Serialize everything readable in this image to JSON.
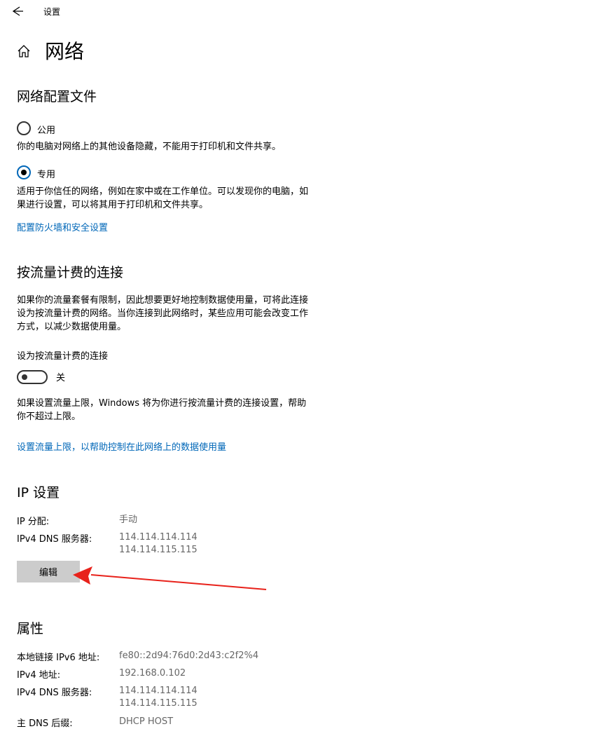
{
  "app_title": "设置",
  "page_title": "网络",
  "profile": {
    "title": "网络配置文件",
    "public_label": "公用",
    "public_desc": "你的电脑对网络上的其他设备隐藏，不能用于打印机和文件共享。",
    "private_label": "专用",
    "private_desc_line1": "适用于你信任的网络，例如在家中或在工作单位。可以发现你的电脑，如",
    "private_desc_line2": "果进行设置，可以将其用于打印机和文件共享。",
    "selected": "专用",
    "firewall_link": "配置防火墙和安全设置"
  },
  "metered": {
    "title": "按流量计费的连接",
    "desc_line1": "如果你的流量套餐有限制，因此想要更好地控制数据使用量，可将此连接",
    "desc_line2": "设为按流量计费的网络。当你连接到此网络时，某些应用可能会改变工作",
    "desc_line3": "方式，以减少数据使用量。",
    "toggle_caption": "设为按流量计费的连接",
    "toggle_state": "关",
    "limit_desc_line1": "如果设置流量上限，Windows 将为你进行按流量计费的连接设置，帮助",
    "limit_desc_line2": "你不超过上限。",
    "limit_link": "设置流量上限，以帮助控制在此网络上的数据使用量"
  },
  "ip": {
    "title": "IP 设置",
    "assign_key": "IP 分配:",
    "assign_value": "手动",
    "dns_key": "IPv4 DNS 服务器:",
    "dns_value_1": "114.114.114.114",
    "dns_value_2": "114.114.115.115",
    "edit_button": "编辑"
  },
  "properties": {
    "title": "属性",
    "ipv6_key": "本地链接 IPv6 地址:",
    "ipv6_value": "fe80::2d94:76d0:2d43:c2f2%4",
    "ipv4_key": "IPv4 地址:",
    "ipv4_value": "192.168.0.102",
    "dns_key": "IPv4 DNS 服务器:",
    "dns_value_1": "114.114.114.114",
    "dns_value_2": "114.114.115.115",
    "suffix_key": "主 DNS 后缀:",
    "suffix_value": "DHCP HOST"
  },
  "colors": {
    "accent": "#0067b8",
    "annotation_arrow": "#e8221b",
    "button_bg": "#cccccc"
  },
  "icons": [
    "back-arrow-icon",
    "home-icon"
  ]
}
